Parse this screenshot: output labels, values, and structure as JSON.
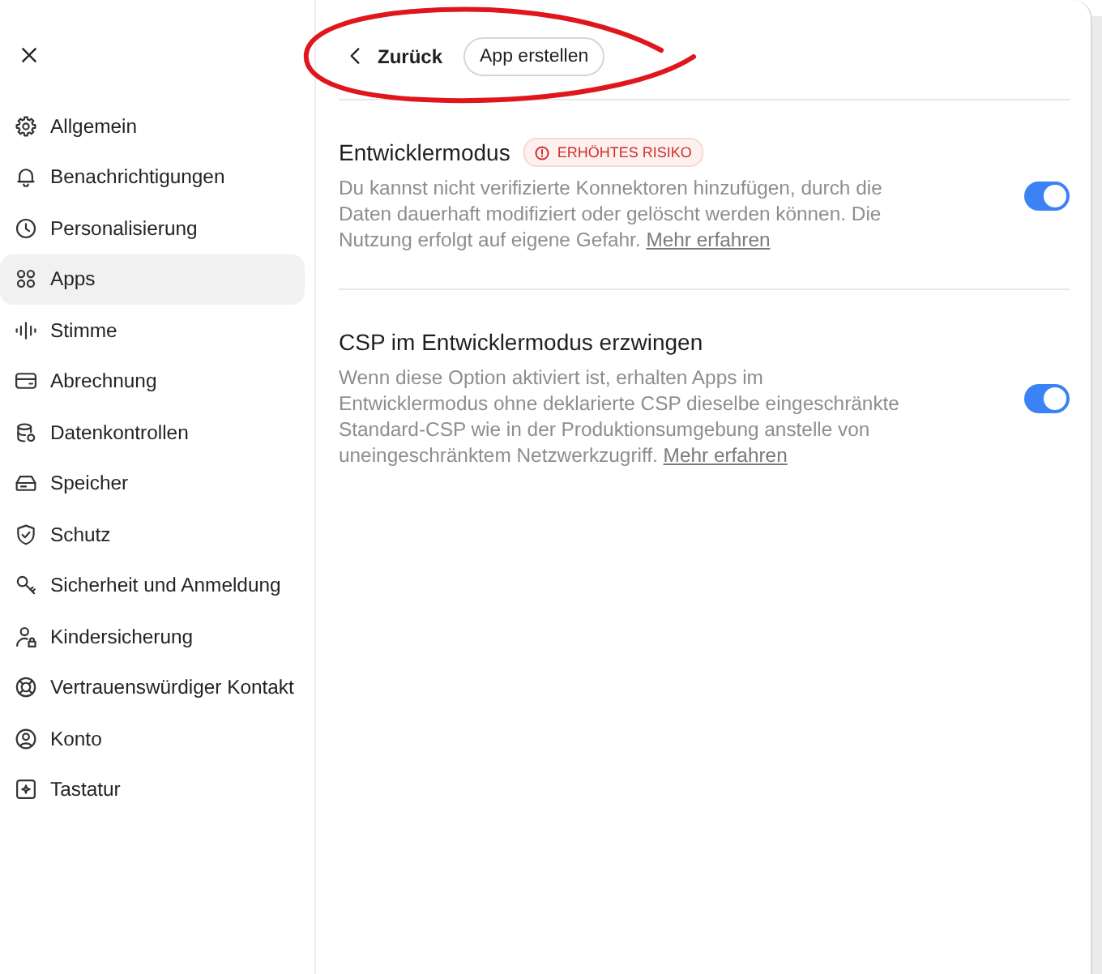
{
  "sidebar": {
    "items": [
      {
        "label": "Allgemein",
        "selected": false
      },
      {
        "label": "Benachrichtigungen",
        "selected": false
      },
      {
        "label": "Personalisierung",
        "selected": false
      },
      {
        "label": "Apps",
        "selected": true
      },
      {
        "label": "Stimme",
        "selected": false
      },
      {
        "label": "Abrechnung",
        "selected": false
      },
      {
        "label": "Datenkontrollen",
        "selected": false
      },
      {
        "label": "Speicher",
        "selected": false
      },
      {
        "label": "Schutz",
        "selected": false
      },
      {
        "label": "Sicherheit und Anmeldung",
        "selected": false
      },
      {
        "label": "Kindersicherung",
        "selected": false
      },
      {
        "label": "Vertrauenswürdiger Kontakt",
        "selected": false
      },
      {
        "label": "Konto",
        "selected": false
      },
      {
        "label": "Tastatur",
        "selected": false
      }
    ]
  },
  "header": {
    "back_label": "Zurück",
    "action_label": "App erstellen"
  },
  "settings": [
    {
      "title": "Entwicklermodus",
      "badge": "ERHÖHTES RISIKO",
      "description": "Du kannst nicht verifizierte Konnektoren hinzufügen, durch die Daten dauerhaft modifiziert oder gelöscht werden können. Die Nutzung erfolgt auf eigene Gefahr.",
      "link": "Mehr erfahren",
      "on": true
    },
    {
      "title": "CSP im Entwicklermodus erzwingen",
      "description": "Wenn diese Option aktiviert ist, erhalten Apps im Entwicklermodus ohne deklarierte CSP dieselbe eingeschränkte Standard-CSP wie in der Produktionsumgebung anstelle von uneingeschränktem Netzwerkzugriff.",
      "link": "Mehr erfahren",
      "on": true
    }
  ],
  "annotation": {
    "kind": "ellipse"
  }
}
